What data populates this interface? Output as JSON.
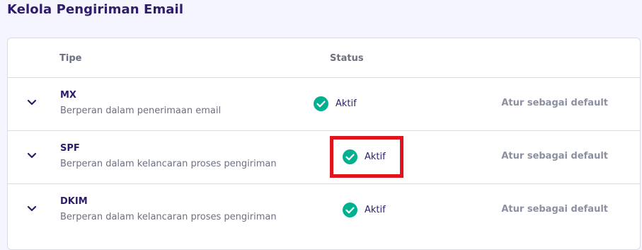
{
  "page": {
    "title": "Kelola Pengiriman Email"
  },
  "table": {
    "headers": {
      "tipe": "Tipe",
      "status": "Status"
    },
    "rows": [
      {
        "name": "MX",
        "description": "Berperan dalam penerimaan email",
        "status": "Aktif",
        "action": "Atur sebagai default"
      },
      {
        "name": "SPF",
        "description": "Berperan dalam kelancaran proses pengiriman",
        "status": "Aktif",
        "action": "Atur sebagai default"
      },
      {
        "name": "DKIM",
        "description": "Berperan dalam kelancaran proses pengiriman",
        "status": "Aktif",
        "action": "Atur sebagai default"
      }
    ]
  },
  "colors": {
    "accent_green": "#00b090",
    "highlight_red": "#e0141e",
    "title_purple": "#2f1c6a"
  },
  "icons": {
    "expand": "chevron-down-icon",
    "status_ok": "check-circle-icon"
  }
}
